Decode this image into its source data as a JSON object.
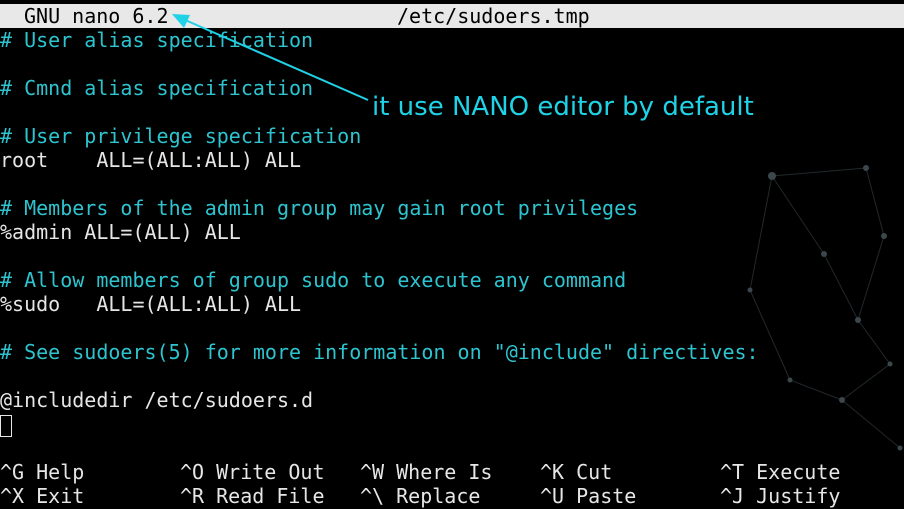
{
  "titlebar": {
    "app": "GNU nano 6.2",
    "filename": "/etc/sudoers.tmp"
  },
  "file_lines": [
    {
      "type": "comment",
      "text": "# User alias specification"
    },
    {
      "type": "blank",
      "text": ""
    },
    {
      "type": "comment",
      "text": "# Cmnd alias specification"
    },
    {
      "type": "blank",
      "text": ""
    },
    {
      "type": "comment",
      "text": "# User privilege specification"
    },
    {
      "type": "normal",
      "text": "root    ALL=(ALL:ALL) ALL"
    },
    {
      "type": "blank",
      "text": ""
    },
    {
      "type": "comment",
      "text": "# Members of the admin group may gain root privileges"
    },
    {
      "type": "normal",
      "text": "%admin ALL=(ALL) ALL"
    },
    {
      "type": "blank",
      "text": ""
    },
    {
      "type": "comment",
      "text": "# Allow members of group sudo to execute any command"
    },
    {
      "type": "normal",
      "text": "%sudo   ALL=(ALL:ALL) ALL"
    },
    {
      "type": "blank",
      "text": ""
    },
    {
      "type": "comment",
      "text": "# See sudoers(5) for more information on \"@include\" directives:"
    },
    {
      "type": "blank",
      "text": ""
    },
    {
      "type": "normal",
      "text": "@includedir /etc/sudoers.d"
    }
  ],
  "shortcuts": {
    "row1": [
      {
        "key": "^G",
        "label": "Help"
      },
      {
        "key": "^O",
        "label": "Write Out"
      },
      {
        "key": "^W",
        "label": "Where Is"
      },
      {
        "key": "^K",
        "label": "Cut"
      },
      {
        "key": "^T",
        "label": "Execute"
      }
    ],
    "row2": [
      {
        "key": "^X",
        "label": "Exit"
      },
      {
        "key": "^R",
        "label": "Read File"
      },
      {
        "key": "^\\",
        "label": "Replace"
      },
      {
        "key": "^U",
        "label": "Paste"
      },
      {
        "key": "^J",
        "label": "Justify"
      }
    ]
  },
  "annotation": {
    "text": "it use NANO editor by default"
  },
  "colors": {
    "background": "#000000",
    "comment": "#2ec4cf",
    "text": "#e6e6e6",
    "titlebar_bg": "#e8e8e8",
    "annotation": "#1fd2e6"
  }
}
